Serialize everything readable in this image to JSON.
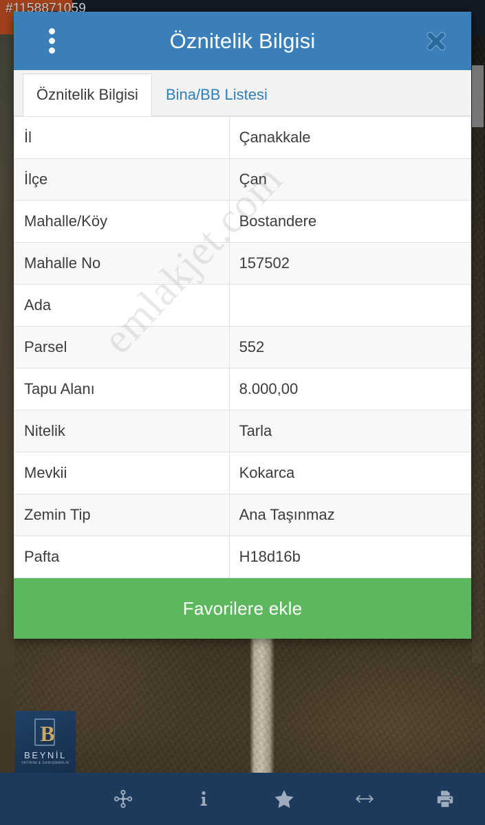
{
  "listing": {
    "id_label": "#1158871059"
  },
  "dialog": {
    "title": "Öznitelik Bilgisi",
    "menu_icon": "kebab-menu-icon",
    "close_icon": "close-icon",
    "tabs": [
      {
        "label": "Öznitelik Bilgisi",
        "active": true
      },
      {
        "label": "Bina/BB Listesi",
        "active": false
      }
    ],
    "watermark": "emlakjet.com",
    "table": {
      "rows": [
        {
          "label": "İl",
          "value": "Çanakkale"
        },
        {
          "label": "İlçe",
          "value": "Çan"
        },
        {
          "label": "Mahalle/Köy",
          "value": "Bostandere"
        },
        {
          "label": "Mahalle No",
          "value": "157502"
        },
        {
          "label": "Ada",
          "value": ""
        },
        {
          "label": "Parsel",
          "value": "552"
        },
        {
          "label": "Tapu Alanı",
          "value": "8.000,00"
        },
        {
          "label": "Nitelik",
          "value": "Tarla"
        },
        {
          "label": "Mevkii",
          "value": "Kokarca"
        },
        {
          "label": "Zemin Tip",
          "value": "Ana Taşınmaz"
        },
        {
          "label": "Pafta",
          "value": "H18d16b"
        }
      ]
    },
    "favorite_button": "Favorilere ekle"
  },
  "bottom_toolbar": {
    "brand": {
      "letter": "B",
      "name": "BEYNİL",
      "tagline": "YATIRIM & DANIŞMANLIK"
    },
    "buttons": [
      {
        "icon": "crosshair-locate-icon"
      },
      {
        "icon": "info-icon"
      },
      {
        "icon": "star-icon"
      },
      {
        "icon": "measure-distance-icon"
      },
      {
        "icon": "print-icon"
      }
    ]
  },
  "colors": {
    "header_blue": "#3a7fba",
    "tab_link_blue": "#2f7fb8",
    "favorite_green": "#5cb85c",
    "toolbar_navy": "#1d3a5c",
    "accent_orange": "#a0411b"
  }
}
